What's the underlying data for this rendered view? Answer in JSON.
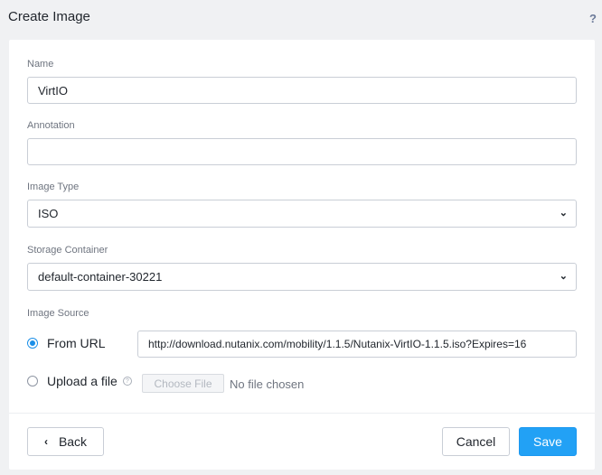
{
  "header": {
    "title": "Create Image",
    "help_glyph": "?"
  },
  "form": {
    "name": {
      "label": "Name",
      "value": "VirtIO"
    },
    "annotation": {
      "label": "Annotation",
      "value": ""
    },
    "image_type": {
      "label": "Image Type",
      "selected": "ISO"
    },
    "storage_container": {
      "label": "Storage Container",
      "selected": "default-container-30221"
    },
    "image_source": {
      "label": "Image Source",
      "from_url": {
        "label": "From URL",
        "checked": true,
        "value": "http://download.nutanix.com/mobility/1.1.5/Nutanix-VirtIO-1.1.5.iso?Expires=16"
      },
      "upload_file": {
        "label": "Upload a file",
        "checked": false,
        "choose_file_label": "Choose File",
        "no_file_text": "No file chosen",
        "info_glyph": "?"
      }
    }
  },
  "footer": {
    "back_label": "Back",
    "back_icon": "chevron-left-icon",
    "cancel_label": "Cancel",
    "save_label": "Save"
  },
  "colors": {
    "accent": "#22a1f5",
    "radio_checked": "#1b8fe8",
    "background": "#f0f1f3"
  }
}
